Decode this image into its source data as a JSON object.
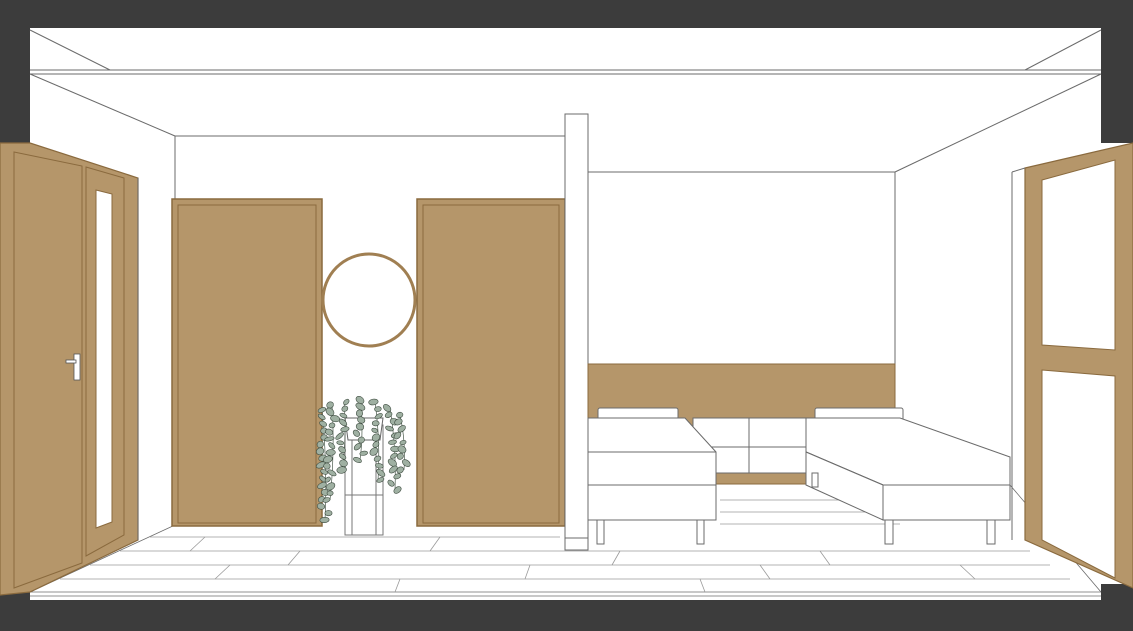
{
  "colors": {
    "wood": "#b5966a",
    "wood_dark": "#8a6a3e",
    "section_cut": "#3c3c3c",
    "wall": "#ffffff",
    "line": "#6b6b6b",
    "plant_leaf": "#9fb0a2"
  },
  "elements": {
    "entrance_door": "entrance-door",
    "closet_door_left": "closet-door-left",
    "closet_door_right": "closet-door-right",
    "round_mirror": "round-mirror",
    "hanging_plant": "hanging-plant",
    "partition_wall": "partition-wall",
    "headboard_panel": "headboard-panel",
    "bed_left": "bed-left",
    "bed_right": "bed-right",
    "nightstand": "nightstand",
    "window": "window"
  }
}
